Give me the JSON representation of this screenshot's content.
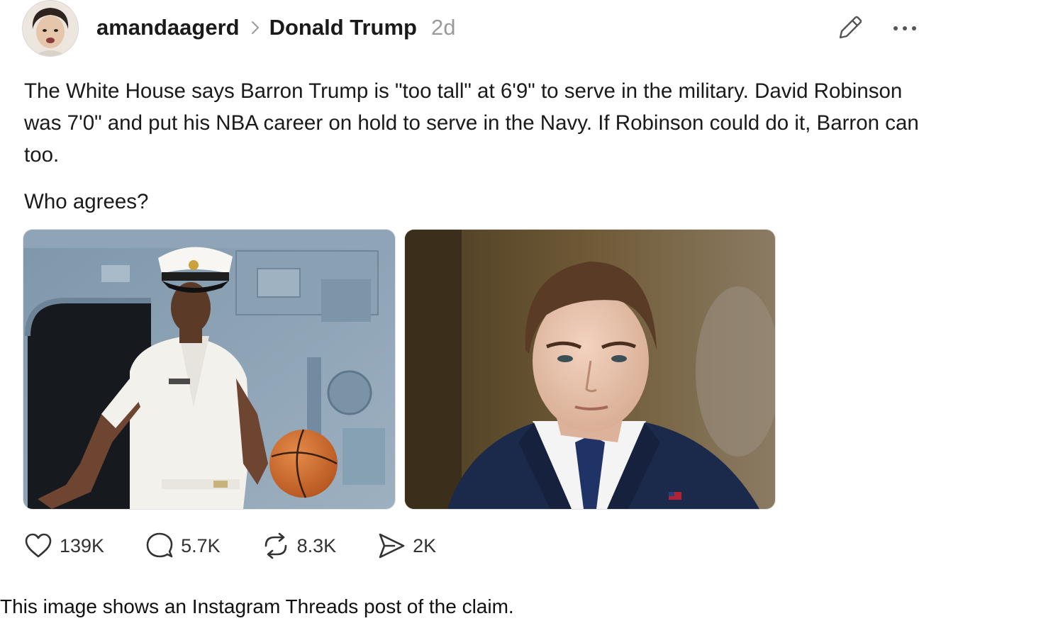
{
  "post": {
    "author": "amandaagerd",
    "topic": "Donald Trump",
    "time": "2d",
    "paragraphs": [
      "The White House says Barron Trump is \"too tall\" at 6'9\" to serve in the military. David Robinson was 7'0\" and put his NBA career on hold to serve in the Navy. If Robinson could do it, Barron can too.",
      "Who agrees?"
    ],
    "icons": {
      "avatar": "avatar",
      "separator": "chevron-right-icon",
      "edit": "pencil-icon",
      "more": "more-options-icon"
    }
  },
  "actions": {
    "likes": "139K",
    "replies": "5.7K",
    "reposts": "8.3K",
    "shares": "2K",
    "icons": [
      "heart-icon",
      "comment-icon",
      "repost-icon",
      "share-icon"
    ]
  },
  "caption": "This image shows an Instagram Threads post of the claim.",
  "colors": {
    "text": "#1a1a1a",
    "muted": "#9a9a9a",
    "icon": "#333333"
  }
}
